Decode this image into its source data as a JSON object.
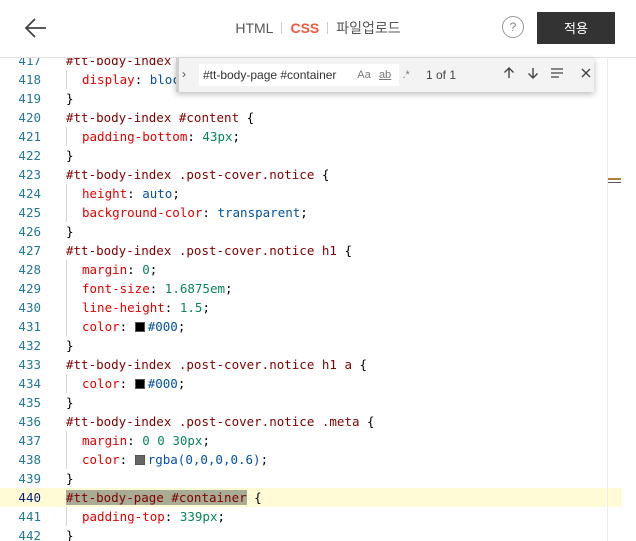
{
  "header": {
    "tabs": [
      {
        "label": "HTML",
        "active": false
      },
      {
        "label": "CSS",
        "active": true
      },
      {
        "label": "파일업로드",
        "active": false
      }
    ],
    "help_label": "?",
    "apply_label": "적용"
  },
  "find": {
    "query": "#tt-body-page #container",
    "match_case": "Aa",
    "whole_word": "ab",
    "regex": ".*",
    "match_count": "1 of 1"
  },
  "colors": {
    "accent": "#ee5a3f",
    "apply_bg": "#333333",
    "swatch_black": "#000000",
    "swatch_rgba": "#666666"
  },
  "code": {
    "current_line": "440",
    "lines": [
      {
        "n": "417",
        "parts": [
          {
            "c": "sel",
            "t": "#tt-body-index"
          }
        ]
      },
      {
        "n": "418",
        "indent": true,
        "parts": [
          {
            "c": "prop",
            "t": "display"
          },
          {
            "c": "",
            "t": ": "
          },
          {
            "c": "kw",
            "t": "block"
          },
          {
            "c": "",
            "t": ";"
          }
        ]
      },
      {
        "n": "419",
        "parts": [
          {
            "c": "",
            "t": "}"
          }
        ]
      },
      {
        "n": "420",
        "parts": [
          {
            "c": "sel",
            "t": "#tt-body-index #content"
          },
          {
            "c": "",
            "t": " {"
          }
        ]
      },
      {
        "n": "421",
        "indent": true,
        "parts": [
          {
            "c": "prop",
            "t": "padding-bottom"
          },
          {
            "c": "",
            "t": ": "
          },
          {
            "c": "val",
            "t": "43px"
          },
          {
            "c": "",
            "t": ";"
          }
        ]
      },
      {
        "n": "422",
        "parts": [
          {
            "c": "",
            "t": "}"
          }
        ]
      },
      {
        "n": "423",
        "parts": [
          {
            "c": "sel",
            "t": "#tt-body-index .post-cover.notice"
          },
          {
            "c": "",
            "t": " {"
          }
        ]
      },
      {
        "n": "424",
        "indent": true,
        "parts": [
          {
            "c": "prop",
            "t": "height"
          },
          {
            "c": "",
            "t": ": "
          },
          {
            "c": "kw",
            "t": "auto"
          },
          {
            "c": "",
            "t": ";"
          }
        ]
      },
      {
        "n": "425",
        "indent": true,
        "parts": [
          {
            "c": "prop",
            "t": "background-color"
          },
          {
            "c": "",
            "t": ": "
          },
          {
            "c": "kw",
            "t": "transparent"
          },
          {
            "c": "",
            "t": ";"
          }
        ]
      },
      {
        "n": "426",
        "parts": [
          {
            "c": "",
            "t": "}"
          }
        ]
      },
      {
        "n": "427",
        "parts": [
          {
            "c": "sel",
            "t": "#tt-body-index .post-cover.notice h1"
          },
          {
            "c": "",
            "t": " {"
          }
        ]
      },
      {
        "n": "428",
        "indent": true,
        "parts": [
          {
            "c": "prop",
            "t": "margin"
          },
          {
            "c": "",
            "t": ": "
          },
          {
            "c": "val",
            "t": "0"
          },
          {
            "c": "",
            "t": ";"
          }
        ]
      },
      {
        "n": "429",
        "indent": true,
        "parts": [
          {
            "c": "prop",
            "t": "font-size"
          },
          {
            "c": "",
            "t": ": "
          },
          {
            "c": "val",
            "t": "1.6875em"
          },
          {
            "c": "",
            "t": ";"
          }
        ]
      },
      {
        "n": "430",
        "indent": true,
        "parts": [
          {
            "c": "prop",
            "t": "line-height"
          },
          {
            "c": "",
            "t": ": "
          },
          {
            "c": "val",
            "t": "1.5"
          },
          {
            "c": "",
            "t": ";"
          }
        ]
      },
      {
        "n": "431",
        "indent": true,
        "parts": [
          {
            "c": "prop",
            "t": "color"
          },
          {
            "c": "",
            "t": ": "
          },
          {
            "c": "swatch",
            "t": "#000000"
          },
          {
            "c": "kw",
            "t": "#000"
          },
          {
            "c": "",
            "t": ";"
          }
        ]
      },
      {
        "n": "432",
        "parts": [
          {
            "c": "",
            "t": "}"
          }
        ]
      },
      {
        "n": "433",
        "parts": [
          {
            "c": "sel",
            "t": "#tt-body-index .post-cover.notice h1 a"
          },
          {
            "c": "",
            "t": " {"
          }
        ]
      },
      {
        "n": "434",
        "indent": true,
        "parts": [
          {
            "c": "prop",
            "t": "color"
          },
          {
            "c": "",
            "t": ": "
          },
          {
            "c": "swatch",
            "t": "#000000"
          },
          {
            "c": "kw",
            "t": "#000"
          },
          {
            "c": "",
            "t": ";"
          }
        ]
      },
      {
        "n": "435",
        "parts": [
          {
            "c": "",
            "t": "}"
          }
        ]
      },
      {
        "n": "436",
        "parts": [
          {
            "c": "sel",
            "t": "#tt-body-index .post-cover.notice .meta"
          },
          {
            "c": "",
            "t": " {"
          }
        ]
      },
      {
        "n": "437",
        "indent": true,
        "parts": [
          {
            "c": "prop",
            "t": "margin"
          },
          {
            "c": "",
            "t": ": "
          },
          {
            "c": "val",
            "t": "0 0 30px"
          },
          {
            "c": "",
            "t": ";"
          }
        ]
      },
      {
        "n": "438",
        "indent": true,
        "parts": [
          {
            "c": "prop",
            "t": "color"
          },
          {
            "c": "",
            "t": ": "
          },
          {
            "c": "swatch",
            "t": "#666666"
          },
          {
            "c": "kw",
            "t": "rgba(0,0,0,0.6)"
          },
          {
            "c": "",
            "t": ";"
          }
        ]
      },
      {
        "n": "439",
        "parts": [
          {
            "c": "",
            "t": "}"
          }
        ]
      },
      {
        "n": "440",
        "parts": [
          {
            "c": "sel hl",
            "t": "#tt-body-page #container"
          },
          {
            "c": "",
            "t": " {"
          }
        ]
      },
      {
        "n": "441",
        "indent": true,
        "parts": [
          {
            "c": "prop",
            "t": "padding-top"
          },
          {
            "c": "",
            "t": ": "
          },
          {
            "c": "val",
            "t": "339px"
          },
          {
            "c": "",
            "t": ";"
          }
        ]
      },
      {
        "n": "442",
        "parts": [
          {
            "c": "",
            "t": "}"
          }
        ]
      }
    ]
  }
}
